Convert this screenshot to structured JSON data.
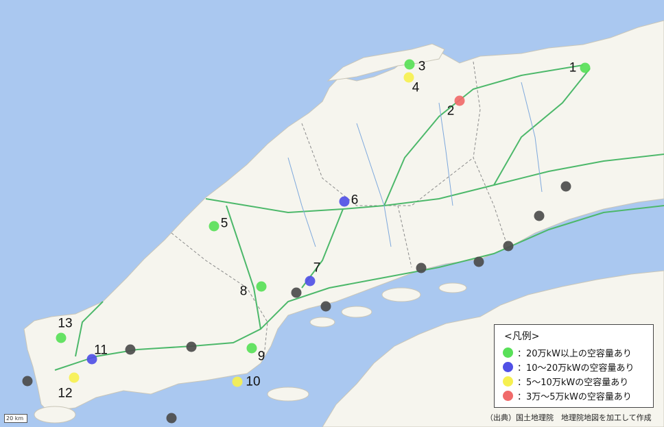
{
  "colors": {
    "sea": "#aac8f0",
    "land": "#f6f5ee",
    "green": "#58e058",
    "blue": "#5050e6",
    "yellow": "#f6f050",
    "red": "#f06a6a",
    "gray": "#4c4c4c"
  },
  "legend": {
    "title": "<凡例>",
    "items": [
      {
        "color": "green",
        "label": "：20万kW以上の空容量あり"
      },
      {
        "color": "blue",
        "label": "：10～20万kWの空容量あり"
      },
      {
        "color": "yellow",
        "label": "：5～10万kWの空容量あり"
      },
      {
        "color": "red",
        "label": "：3万～5万kWの空容量あり"
      }
    ]
  },
  "sites": [
    {
      "id": "1",
      "category": "green"
    },
    {
      "id": "2",
      "category": "red"
    },
    {
      "id": "3",
      "category": "green"
    },
    {
      "id": "4",
      "category": "yellow"
    },
    {
      "id": "5",
      "category": "green"
    },
    {
      "id": "6",
      "category": "blue"
    },
    {
      "id": "7",
      "category": "blue"
    },
    {
      "id": "8",
      "category": "green"
    },
    {
      "id": "9",
      "category": "green"
    },
    {
      "id": "10",
      "category": "yellow"
    },
    {
      "id": "11",
      "category": "blue"
    },
    {
      "id": "12",
      "category": "yellow"
    },
    {
      "id": "13",
      "category": "green"
    }
  ],
  "unnumbered_point_category": "gray",
  "unnumbered_point_count": 11,
  "scale_label": "20 km",
  "source": "（出典）国土地理院　地理院地図を加工して作成"
}
